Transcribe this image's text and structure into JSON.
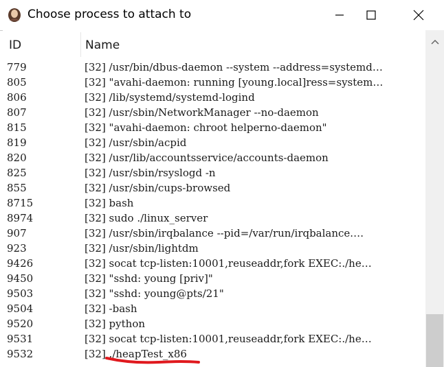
{
  "window": {
    "title": "Choose process to attach to",
    "icon": "avatar-portrait-icon",
    "controls": [
      "minimize-icon",
      "maximize-icon",
      "close-icon"
    ]
  },
  "columns": {
    "id": "ID",
    "name": "Name"
  },
  "processes": [
    {
      "id": "779",
      "name": "[32] /usr/bin/dbus-daemon --system --address=systemd…"
    },
    {
      "id": "805",
      "name": "[32] \"avahi-daemon: running [young.local]ress=system…"
    },
    {
      "id": "806",
      "name": "[32] /lib/systemd/systemd-logind"
    },
    {
      "id": "807",
      "name": "[32] /usr/sbin/NetworkManager --no-daemon"
    },
    {
      "id": "815",
      "name": "[32] \"avahi-daemon: chroot helperno-daemon\""
    },
    {
      "id": "819",
      "name": "[32] /usr/sbin/acpid"
    },
    {
      "id": "820",
      "name": "[32] /usr/lib/accountsservice/accounts-daemon"
    },
    {
      "id": "825",
      "name": "[32] /usr/sbin/rsyslogd -n"
    },
    {
      "id": "855",
      "name": "[32] /usr/sbin/cups-browsed"
    },
    {
      "id": "8715",
      "name": "[32] bash"
    },
    {
      "id": "8974",
      "name": "[32] sudo ./linux_server"
    },
    {
      "id": "907",
      "name": "[32] /usr/sbin/irqbalance --pid=/var/run/irqbalance.…"
    },
    {
      "id": "923",
      "name": "[32] /usr/sbin/lightdm"
    },
    {
      "id": "9426",
      "name": "[32] socat tcp-listen:10001,reuseaddr,fork EXEC:./he…"
    },
    {
      "id": "9450",
      "name": "[32] \"sshd: young [priv]\""
    },
    {
      "id": "9503",
      "name": "[32] \"sshd: young@pts/21\""
    },
    {
      "id": "9504",
      "name": "[32] -bash"
    },
    {
      "id": "9520",
      "name": "[32] python"
    },
    {
      "id": "9531",
      "name": "[32] socat tcp-listen:10001,reuseaddr,fork EXEC:./he…"
    },
    {
      "id": "9532",
      "name": "[32] ./heapTest_x86"
    }
  ],
  "annotation": {
    "color": "#e0191e",
    "target": "9532"
  },
  "colors": {
    "scrollbar_track": "#f0f0f0",
    "scrollbar_thumb": "#cdcdcd",
    "text": "#1a1a1a"
  }
}
